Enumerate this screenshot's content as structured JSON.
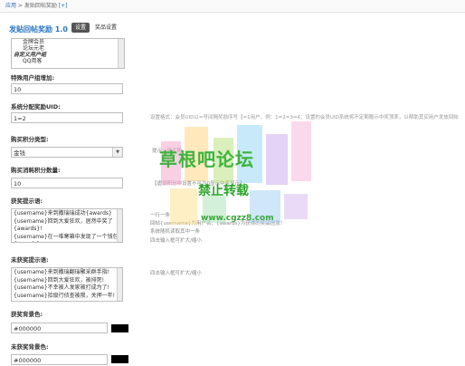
{
  "breadcrumb": {
    "app": "应用",
    "sep": " > ",
    "plugin": "发贴回帖奖励",
    "tag": "[+]"
  },
  "plugin": {
    "title": "发贴回帖奖励 1.0",
    "tabs": [
      {
        "label": "设置",
        "active": true
      },
      {
        "label": "奖品设置",
        "active": false
      }
    ]
  },
  "groups": {
    "items": [
      "金牌会员",
      "论坛元老",
      "自定义用户组",
      "QQ用客"
    ]
  },
  "special_users": {
    "label": "特殊用户组增加:",
    "value": "10"
  },
  "uid_setting": {
    "label": "系统分配奖励UID:",
    "value": "1=2",
    "hint": "设置格式：会员UID以=号间隔奖励序号【=1用户，例：1=2=3=4；设置的会员UID系统将不定期赠示中奖顶率，以帮助其实用户发放回帖"
  },
  "points_type": {
    "label": "购买积分类型:",
    "value": "金钱",
    "hint": "提示：用于购..."
  },
  "points_amount": {
    "label": "购买消耗积分数量:",
    "value": "10",
    "hint": "【虚设积分中设置不可为0显示中奖显示】"
  },
  "win_tips": {
    "label": "获奖提示语:",
    "lines": [
      "{username}来到撒瑞瑞成功{awards}",
      "{username}回到大爱狂欢，居然中奖了{awards}!",
      "{username}在一堆寒箱中发现了一个钱包{awards}"
    ],
    "hint_line1": "一行一条",
    "hint_line2": "回帖{username}为用户名，{awards}为获得的奖品信息！",
    "hint_line3": "系统随机读取其中一条",
    "hint_line4": "四击输入框可扩大/缩小"
  },
  "lose_tips": {
    "label": "未获奖提示语:",
    "lines": [
      "{username}来到撒瑞翻瑞聚采群手指!",
      "{username}回到大爱狂欢，被排死!",
      "{username}不幸被人发家被打成为了!",
      "{username}拾级行侦查被陨，关押一年!"
    ],
    "hint": "四击输入框可扩大/缩小"
  },
  "win_bg": {
    "label": "获奖背景色:",
    "value": "#000000"
  },
  "lose_bg": {
    "label": "未获奖背景色:",
    "value": "#000000"
  },
  "watermark": {
    "line1": "草根吧论坛",
    "line2": "禁止转载",
    "line3": "www.cgzz8.com"
  }
}
